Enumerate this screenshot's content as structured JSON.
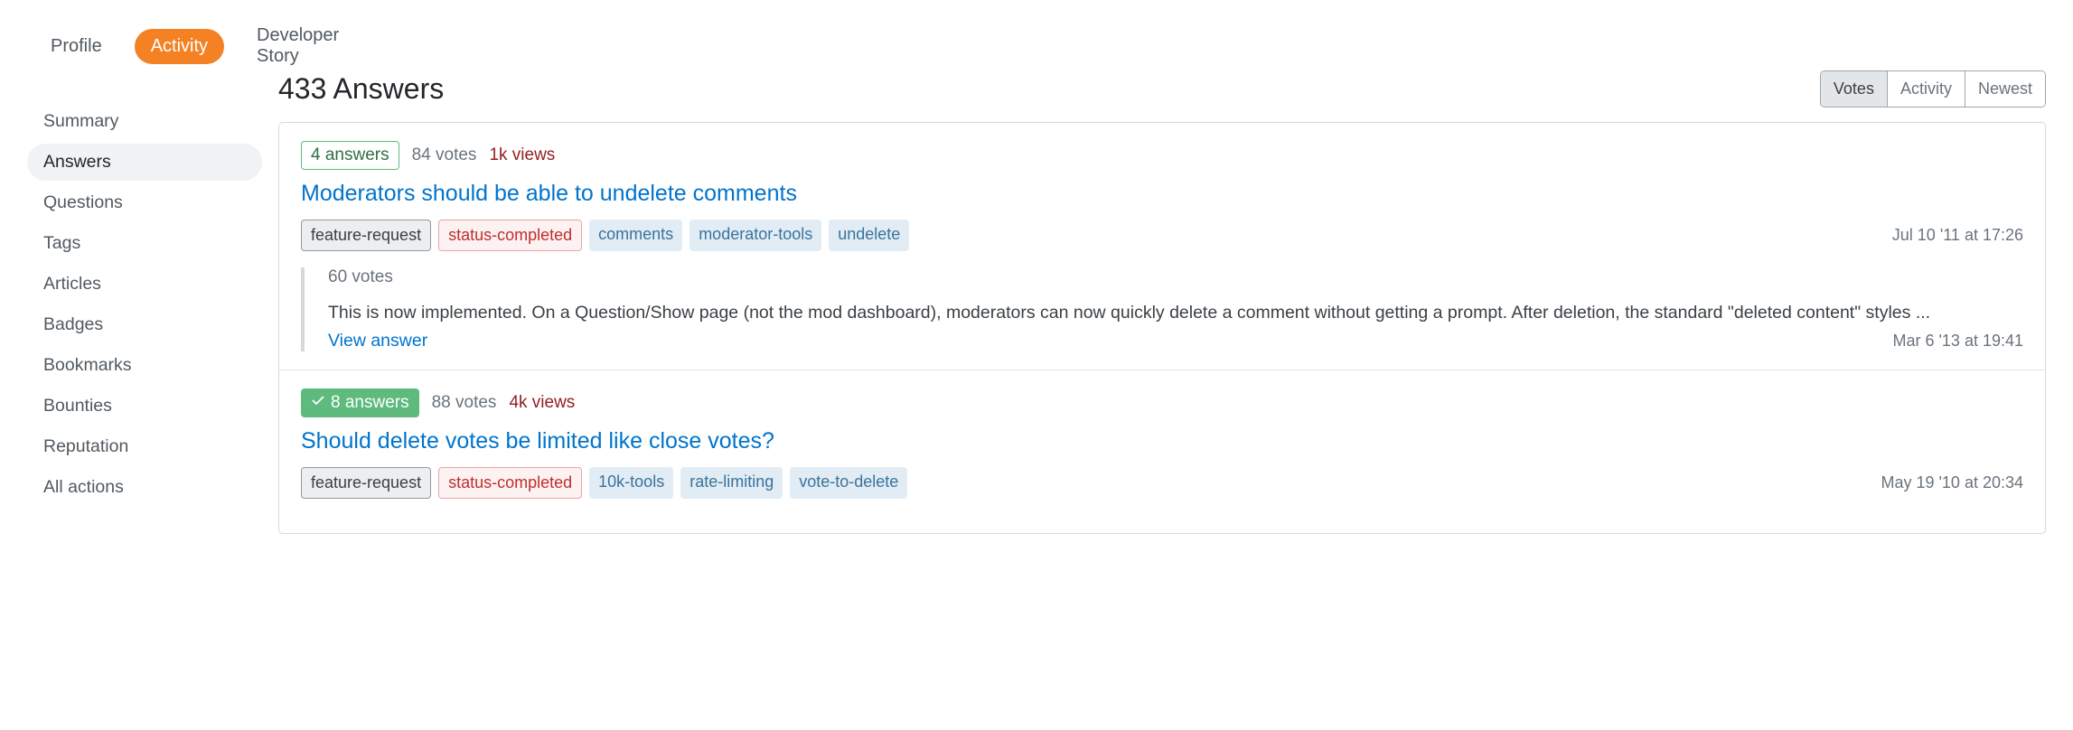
{
  "top_tabs": {
    "profile": "Profile",
    "activity": "Activity",
    "devstory": "Developer Story"
  },
  "side_nav": {
    "summary": "Summary",
    "answers": "Answers",
    "questions": "Questions",
    "tags": "Tags",
    "articles": "Articles",
    "badges": "Badges",
    "bookmarks": "Bookmarks",
    "bounties": "Bounties",
    "reputation": "Reputation",
    "all_actions": "All actions"
  },
  "heading": "433 Answers",
  "sort": {
    "votes": "Votes",
    "activity": "Activity",
    "newest": "Newest"
  },
  "answers": [
    {
      "answer_badge": "4 answers",
      "accepted": false,
      "votes": "84 votes",
      "views": "1k views",
      "title": "Moderators should be able to undelete comments",
      "tags": [
        {
          "label": "feature-request",
          "kind": "required"
        },
        {
          "label": "status-completed",
          "kind": "status"
        },
        {
          "label": "comments",
          "kind": "normal"
        },
        {
          "label": "moderator-tools",
          "kind": "normal"
        },
        {
          "label": "undelete",
          "kind": "normal"
        }
      ],
      "asked": "Jul 10 '11 at 17:26",
      "excerpt": {
        "votes": "60 votes",
        "body": "This is now implemented. On a Question/Show page (not the mod dashboard), moderators can now quickly delete a comment without getting a prompt. After deletion, the standard \"deleted content\" styles ...",
        "view": "View answer",
        "answered": "Mar 6 '13 at 19:41"
      }
    },
    {
      "answer_badge": "8 answers",
      "accepted": true,
      "votes": "88 votes",
      "views": "4k views",
      "title": "Should delete votes be limited like close votes?",
      "tags": [
        {
          "label": "feature-request",
          "kind": "required"
        },
        {
          "label": "status-completed",
          "kind": "status"
        },
        {
          "label": "10k-tools",
          "kind": "normal"
        },
        {
          "label": "rate-limiting",
          "kind": "normal"
        },
        {
          "label": "vote-to-delete",
          "kind": "normal"
        }
      ],
      "asked": "May 19 '10 at 20:34"
    }
  ]
}
